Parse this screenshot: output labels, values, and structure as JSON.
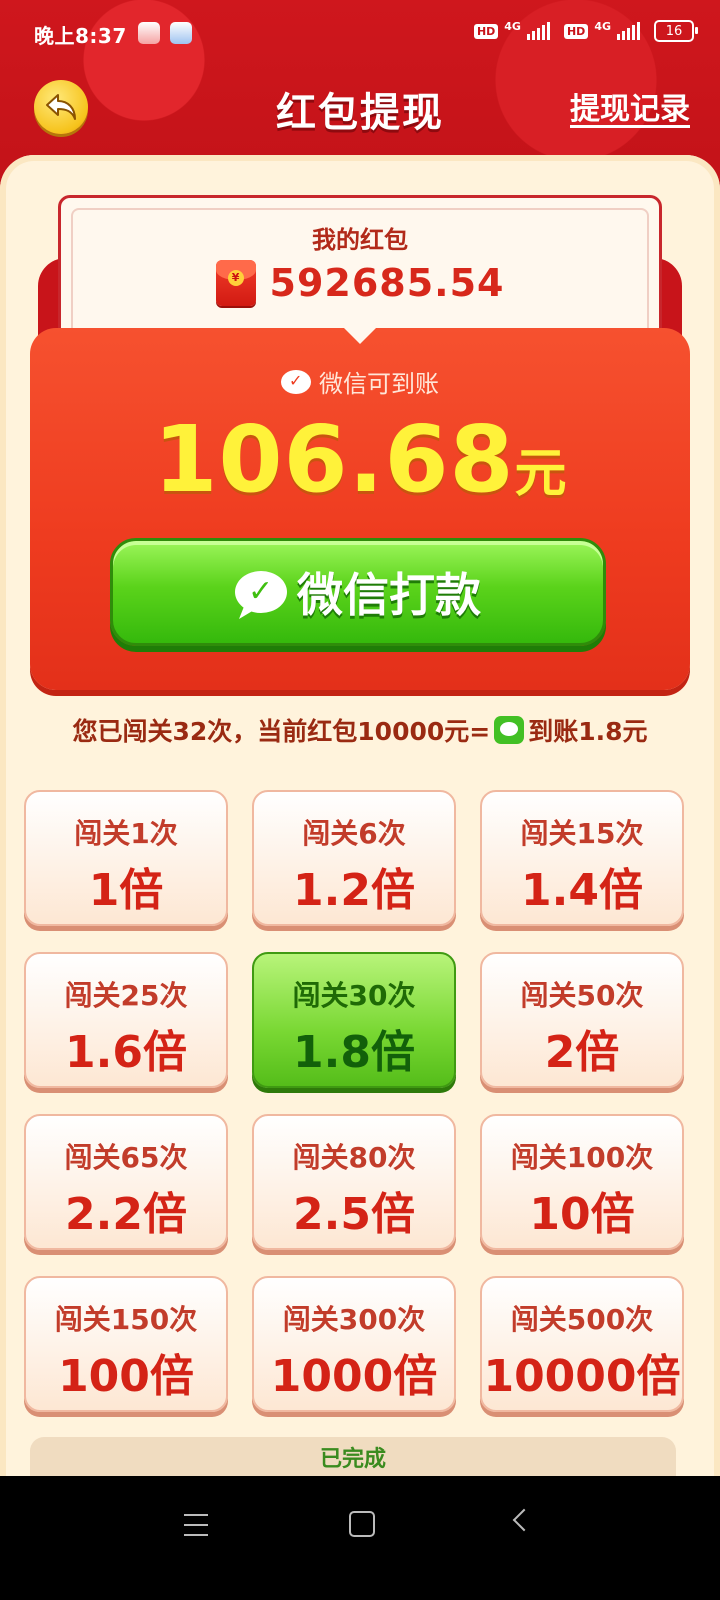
{
  "status_bar": {
    "time": "晚上8:37",
    "network_1": "4G",
    "network_2": "4G",
    "hd_label": "HD",
    "battery": "16"
  },
  "header": {
    "title": "红包提现",
    "history_link": "提现记录",
    "back_icon": "back-arrow-icon"
  },
  "balance": {
    "label": "我的红包",
    "amount": "592685.54"
  },
  "payout": {
    "wechat_label": "微信可到账",
    "amount": "106.68",
    "unit": "元",
    "button_label": "微信打款"
  },
  "progress": {
    "text_before": "您已闯关32次，当前红包10000元=",
    "text_after": "到账1.8元"
  },
  "tiers": [
    {
      "req": "闯关1次",
      "mult": "1倍"
    },
    {
      "req": "闯关6次",
      "mult": "1.2倍"
    },
    {
      "req": "闯关15次",
      "mult": "1.4倍"
    },
    {
      "req": "闯关25次",
      "mult": "1.6倍"
    },
    {
      "req": "闯关30次",
      "mult": "1.8倍"
    },
    {
      "req": "闯关50次",
      "mult": "2倍"
    },
    {
      "req": "闯关65次",
      "mult": "2.2倍"
    },
    {
      "req": "闯关80次",
      "mult": "2.5倍"
    },
    {
      "req": "闯关100次",
      "mult": "10倍"
    },
    {
      "req": "闯关150次",
      "mult": "100倍"
    },
    {
      "req": "闯关300次",
      "mult": "1000倍"
    },
    {
      "req": "闯关500次",
      "mult": "10000倍"
    }
  ],
  "active_tier_index": 4,
  "footer": {
    "done_label": "已完成"
  },
  "colors": {
    "brand_red": "#c8141a",
    "accent_yellow": "#fff23a",
    "wechat_green": "#5bd31b",
    "panel_bg": "#fff3dc"
  }
}
